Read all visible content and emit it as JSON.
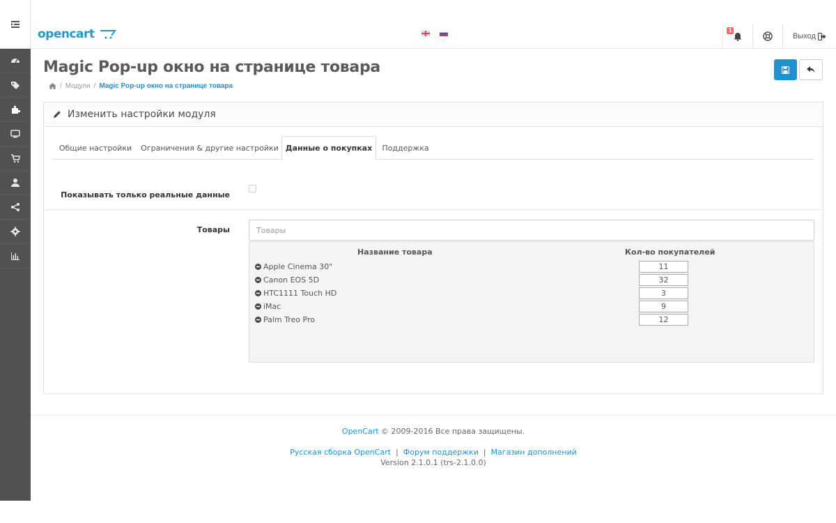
{
  "header": {
    "logo_text": "opencart",
    "logout_label": "Выход",
    "alerts_count": "1",
    "flags": [
      "en-gb-flag",
      "ru-flag"
    ]
  },
  "sidebar": {
    "items": [
      "dashboard",
      "catalog",
      "extensions",
      "design",
      "sales",
      "customers",
      "marketing",
      "system",
      "reports"
    ]
  },
  "page": {
    "title": "Magic Pop-up окно на странице товара",
    "breadcrumb": [
      "Модули",
      "Magic Pop-up окно на странице товара"
    ]
  },
  "panel": {
    "heading": "Изменить настройки модуля",
    "tabs": [
      {
        "label": "Общие настройки",
        "active": false
      },
      {
        "label": "Ограничения & другие настройки",
        "active": false
      },
      {
        "label": "Данные о покупках",
        "active": true
      },
      {
        "label": "Поддержка",
        "active": false
      }
    ],
    "real_data_label": "Показывать только реальные данные",
    "real_data_checked": false,
    "products_label": "Товары",
    "products_placeholder": "Товары",
    "table": {
      "col_name": "Название товара",
      "col_count": "Кол-во покупателей",
      "rows": [
        {
          "name": "Apple Cinema 30\"",
          "count": "11"
        },
        {
          "name": "Canon EOS 5D",
          "count": "32"
        },
        {
          "name": "HTC1111 Touch HD",
          "count": "3"
        },
        {
          "name": "iMac",
          "count": "9"
        },
        {
          "name": "Palm Treo Pro",
          "count": "12"
        }
      ]
    }
  },
  "footer": {
    "brand": "OpenCart",
    "copyright": "© 2009-2016 Все права защищены.",
    "links": [
      "Русская сборка OpenCart",
      "Форум поддержки",
      "Магазин дополнений"
    ],
    "version": "Version 2.1.0.1 (trs-2.1.0.0)"
  },
  "colors": {
    "accent": "#1e91cf",
    "sidebar_bg": "#515151",
    "badge": "#f56b6b"
  }
}
